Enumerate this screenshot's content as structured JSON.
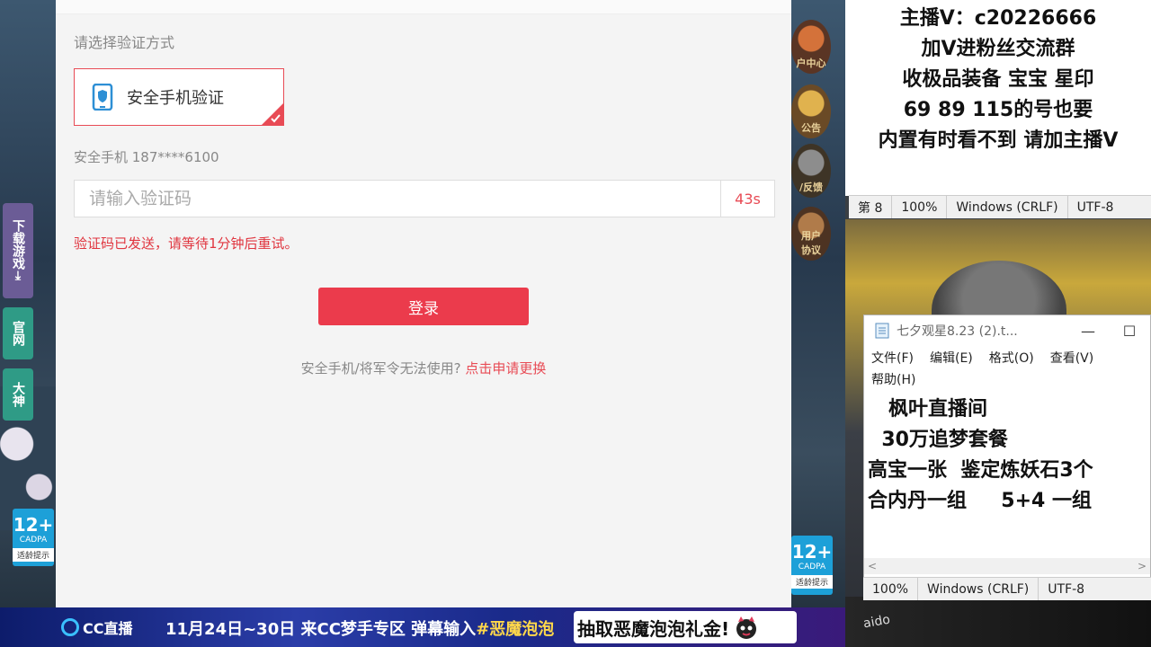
{
  "dialog": {
    "method_label": "请选择验证方式",
    "method_option": "安全手机验证",
    "phone_line": "安全手机 187****6100",
    "code_placeholder": "请输入验证码",
    "countdown": "43s",
    "error": "验证码已发送，请等待1分钟后重试。",
    "login_label": "登录",
    "help_text": "安全手机/将军令无法使用?",
    "help_link": "点击申请更换",
    "accent_color": "#eb3b4c"
  },
  "game_sidebar": {
    "tabs": [
      "下载游戏",
      "官网",
      "大神"
    ],
    "download_arrow": "⤓",
    "icons": [
      "用户中心",
      "公告",
      "反馈",
      "用户协议"
    ],
    "icon_labels": [
      "户中心",
      "公告",
      "/反馈",
      "用户\n协议"
    ],
    "age_badge": {
      "rating": "12+",
      "org": "CADPA",
      "tip": "适龄提示"
    }
  },
  "promo_note": {
    "lines": [
      "主播V：c20226666",
      "加V进粉丝交流群",
      "收极品装备 宝宝 星印",
      "69 89 115的号也要",
      "内置有时看不到 请加主播V"
    ]
  },
  "statusbar_top": [
    "第 8",
    "100%",
    "Windows (CRLF)",
    "UTF-8"
  ],
  "notepad": {
    "title": "七夕观星8.23 (2).t...",
    "min": "—",
    "max": "☐",
    "menu": [
      "文件(F)",
      "编辑(E)",
      "格式(O)",
      "查看(V)",
      "帮助(H)"
    ],
    "lines": [
      "   枫叶直播间",
      "  30万追梦套餐",
      "",
      "高宝一张  鉴定炼妖石3个",
      "合内丹一组     5+4 一组"
    ],
    "scroll_left": "<",
    "scroll_right": ">",
    "status": [
      "100%",
      "Windows (CRLF)",
      "UTF-8"
    ]
  },
  "keyboard_brand": "aido",
  "banner": {
    "logo": "CC直播",
    "text_prefix": "11月24日~30日 来CC梦手专区 弹幕输入",
    "text_highlight": "#恶魔泡泡",
    "badge": "抽取恶魔泡泡礼金!"
  }
}
